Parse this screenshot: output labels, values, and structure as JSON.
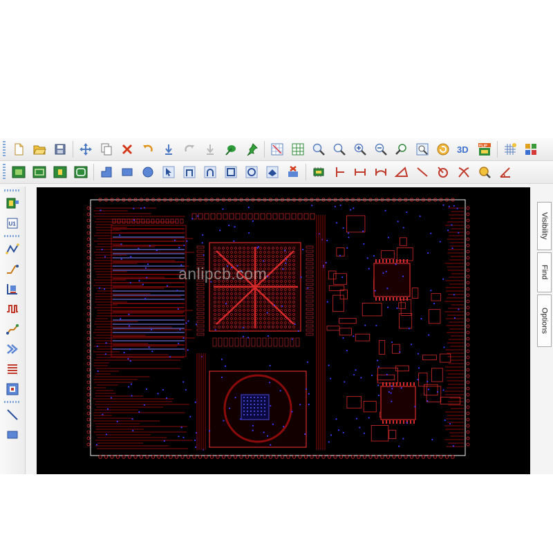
{
  "colors": {
    "board_outline": "#f0f0f0",
    "copper": "#8b0a0a",
    "copper_bright": "#d62a2a",
    "via": "#3c3cff",
    "background": "#000000"
  },
  "toolbar_top": {
    "buttons": [
      "new-file-icon",
      "open-folder-icon",
      "save-icon",
      "move-icon",
      "copy-icon",
      "delete-icon",
      "undo-icon",
      "download-icon",
      "redo-icon",
      "import-icon",
      "green-leaf-icon",
      "pin-icon",
      "grid-select-icon",
      "grid-green-icon",
      "zoom-area-icon",
      "zoom-fit-icon",
      "zoom-in-icon",
      "zoom-out-icon",
      "zoom-prev-icon",
      "zoom-window-icon",
      "refresh-icon",
      "3d-view-icon",
      "flip-board-icon",
      "grid-icon",
      "layers-icon"
    ],
    "labels": {
      "three_d": "3D",
      "flip": "FLIP"
    }
  },
  "toolbar_bottom": {
    "buttons": [
      "layer-top-icon",
      "layer-inner-icon",
      "layer-mid-icon",
      "layer-bottom-icon",
      "corner-shape-icon",
      "rectangle-icon",
      "circle-icon",
      "arrow-select-icon",
      "arc-route-icon",
      "arc-round-icon",
      "square-icon",
      "square-circle-icon",
      "pad-icon",
      "delete-pad-icon",
      "component-icon",
      "dimension-start-icon",
      "dimension-icon",
      "dimension-arc-icon",
      "angle-icon",
      "line-icon",
      "circle-cut-icon",
      "cross-icon",
      "zoom-component-icon",
      "angle-tool-icon"
    ]
  },
  "left_toolbar": {
    "buttons": [
      "component-place-icon",
      "u1-part-icon",
      "route-trace-icon",
      "route-diff-icon",
      "board-edge-icon",
      "meander-icon",
      "fanout-icon",
      "bus-route-icon",
      "layer-stack-icon",
      "drc-check-icon",
      "line-draw-icon",
      "rectangle-draw-icon"
    ],
    "u1_label": "U1"
  },
  "canvas": {
    "watermark": "anlipcb.com"
  },
  "right_tabs": [
    "Visibility",
    "Find",
    "Options"
  ]
}
